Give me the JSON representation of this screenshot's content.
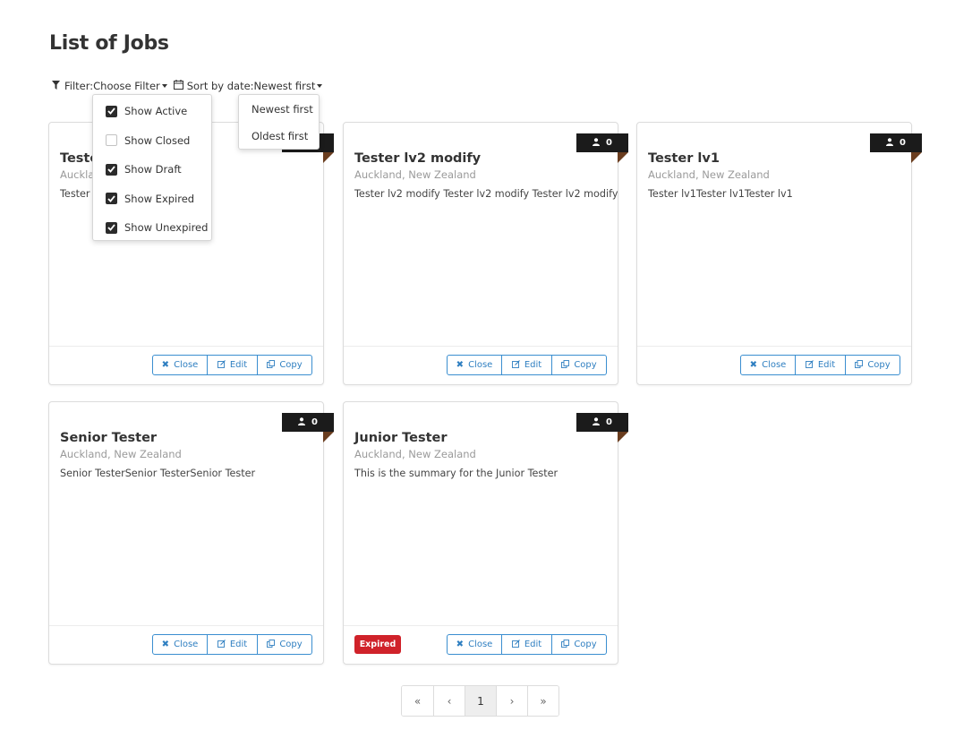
{
  "page": {
    "title": "List of Jobs"
  },
  "toolbar": {
    "filter_label": "Filter:",
    "filter_value": "Choose Filter",
    "sort_label": "Sort by date:",
    "sort_value": "Newest first"
  },
  "filter_menu": {
    "options": [
      {
        "label": "Show Active",
        "checked": true
      },
      {
        "label": "Show Closed",
        "checked": false
      },
      {
        "label": "Show Draft",
        "checked": true
      },
      {
        "label": "Show Expired",
        "checked": true
      },
      {
        "label": "Show Unexpired",
        "checked": true
      }
    ]
  },
  "sort_menu": {
    "options": [
      "Newest first",
      "Oldest first"
    ]
  },
  "actions": {
    "close": "Close",
    "edit": "Edit",
    "copy": "Copy"
  },
  "jobs": [
    {
      "title": "Tester",
      "location": "Auckland, New Zealand",
      "summary": "Tester lv2 Tester lv2",
      "applicants": "0"
    },
    {
      "title": "Tester lv2 modify",
      "location": "Auckland, New Zealand",
      "summary": "Tester lv2 modify Tester lv2 modify Tester lv2 modify",
      "applicants": "0"
    },
    {
      "title": "Tester lv1",
      "location": "Auckland, New Zealand",
      "summary": "Tester lv1Tester lv1Tester lv1",
      "applicants": "0"
    },
    {
      "title": "Senior Tester",
      "location": "Auckland, New Zealand",
      "summary": "Senior TesterSenior TesterSenior Tester",
      "applicants": "0"
    },
    {
      "title": "Junior Tester",
      "location": "Auckland, New Zealand",
      "summary": "This is the summary for the Junior Tester",
      "applicants": "0",
      "status": "Expired"
    }
  ],
  "pagination": {
    "first": "«",
    "prev": "‹",
    "current": "1",
    "next": "›",
    "last": "»"
  },
  "colors": {
    "accent": "#2f7fc1",
    "expired": "#d0222a",
    "ribbon": "#1b1b1b",
    "ribbon_fold": "#6a3d1f"
  },
  "icons": {
    "filter": "funnel-icon",
    "sort": "calendar-icon",
    "applicants": "user-icon",
    "close": "x-icon",
    "edit": "pencil-square-icon",
    "copy": "copy-icon"
  }
}
